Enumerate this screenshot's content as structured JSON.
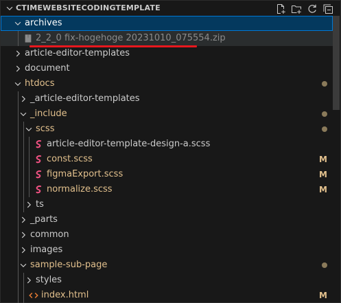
{
  "explorer": {
    "title": "CTIMEWEBSITECODINGTEMPLATE",
    "actions": [
      "new-file-icon",
      "new-folder-icon",
      "refresh-icon",
      "collapse-all-icon"
    ]
  },
  "colors": {
    "folder": "#cccccc",
    "modified": "#e2c08d",
    "scss": "#f55385",
    "html": "#e37933",
    "muted_file": "#8b8b8b",
    "selected_bg": "#04395e",
    "annotation": "#e8171d"
  },
  "tree": [
    {
      "label": "archives",
      "type": "folder",
      "open": true,
      "depth": 0,
      "selected": true
    },
    {
      "label": "2_2_0 fix-hogehoge 20231010_075554.zip",
      "type": "zip",
      "depth": 1,
      "hover": true
    },
    {
      "label": "article-editor-templates",
      "type": "folder",
      "open": false,
      "depth": 0
    },
    {
      "label": "document",
      "type": "folder",
      "open": false,
      "depth": 0
    },
    {
      "label": "htdocs",
      "type": "folder",
      "open": true,
      "depth": 0,
      "status": "dot",
      "modified": true
    },
    {
      "label": "_article-editor-templates",
      "type": "folder",
      "open": false,
      "depth": 1
    },
    {
      "label": "_include",
      "type": "folder",
      "open": true,
      "depth": 1,
      "status": "dot",
      "modified": true
    },
    {
      "label": "scss",
      "type": "folder",
      "open": true,
      "depth": 2,
      "status": "dot",
      "modified": true
    },
    {
      "label": "article-editor-template-design-a.scss",
      "type": "scss",
      "depth": 3
    },
    {
      "label": "const.scss",
      "type": "scss",
      "depth": 3,
      "status": "M",
      "modified": true
    },
    {
      "label": "figmaExport.scss",
      "type": "scss",
      "depth": 3,
      "status": "M",
      "modified": true
    },
    {
      "label": "normalize.scss",
      "type": "scss",
      "depth": 3,
      "status": "M",
      "modified": true
    },
    {
      "label": "ts",
      "type": "folder",
      "open": false,
      "depth": 2
    },
    {
      "label": "_parts",
      "type": "folder",
      "open": false,
      "depth": 1
    },
    {
      "label": "common",
      "type": "folder",
      "open": false,
      "depth": 1
    },
    {
      "label": "images",
      "type": "folder",
      "open": false,
      "depth": 1
    },
    {
      "label": "sample-sub-page",
      "type": "folder",
      "open": true,
      "depth": 1,
      "status": "dot",
      "modified": true
    },
    {
      "label": "styles",
      "type": "folder",
      "open": false,
      "depth": 2
    },
    {
      "label": "index.html",
      "type": "html",
      "depth": 2,
      "status": "M",
      "modified": true
    }
  ]
}
